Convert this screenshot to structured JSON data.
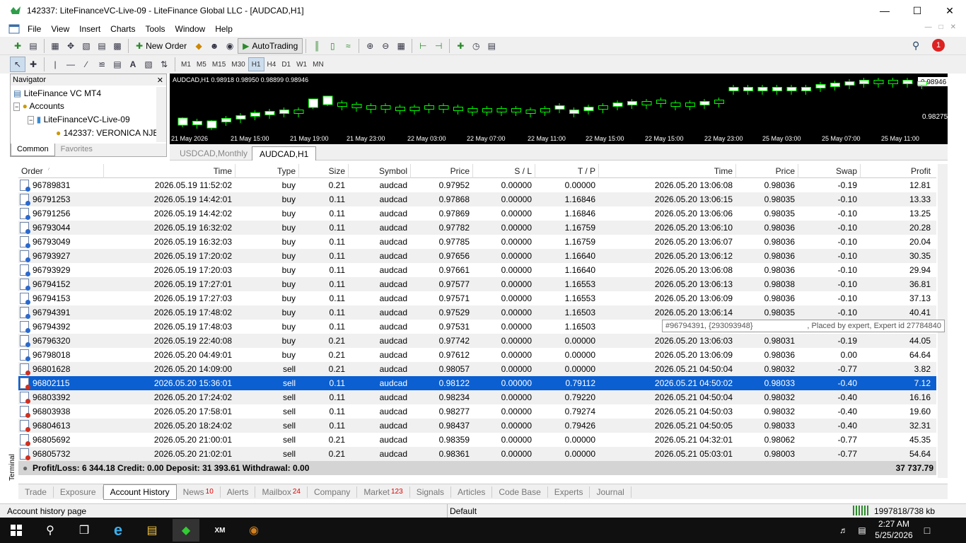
{
  "window": {
    "title": "142337: LiteFinanceVC-Live-09 - LiteFinance Global LLC - [AUDCAD,H1]"
  },
  "menu": [
    "File",
    "View",
    "Insert",
    "Charts",
    "Tools",
    "Window",
    "Help"
  ],
  "toolbar": {
    "new_order": "New Order",
    "autotrading": "AutoTrading",
    "timeframes": [
      "M1",
      "M5",
      "M15",
      "M30",
      "H1",
      "H4",
      "D1",
      "W1",
      "MN"
    ],
    "active_timeframe": "H1",
    "alert_count": "1"
  },
  "navigator": {
    "title": "Navigator",
    "root": "LiteFinance VC MT4",
    "accounts": "Accounts",
    "server": "LiteFinanceVC-Live-09",
    "account": "142337: VERONICA NJE",
    "tabs": [
      "Common",
      "Favorites"
    ]
  },
  "chart": {
    "header": "AUDCAD,H1  0.98918 0.98950 0.98899 0.98946",
    "price_labels": [
      "0.98946",
      "0.98275"
    ],
    "time_labels": [
      "21 May 2026",
      "21 May 15:00",
      "21 May 19:00",
      "21 May 23:00",
      "22 May 03:00",
      "22 May 07:00",
      "22 May 11:00",
      "22 May 15:00",
      "22 May 15:00",
      "22 May 23:00",
      "25 May 03:00",
      "25 May 07:00",
      "25 May 11:00"
    ],
    "tabs": [
      "USDCAD,Monthly",
      "AUDCAD,H1"
    ],
    "colors": {
      "bull": "#ffffff",
      "bear": "#000000",
      "outline": "#00ff00",
      "bg": "#000000"
    }
  },
  "grid": {
    "headers": [
      "Order",
      "Time",
      "Type",
      "Size",
      "Symbol",
      "Price",
      "S / L",
      "T / P",
      "Time",
      "Price",
      "Swap",
      "Profit"
    ],
    "rows": [
      [
        "96789831",
        "2026.05.19 11:52:02",
        "buy",
        "0.21",
        "audcad",
        "0.97952",
        "0.00000",
        "0.00000",
        "2026.05.20 13:06:08",
        "0.98036",
        "-0.19",
        "12.81"
      ],
      [
        "96791253",
        "2026.05.19 14:42:01",
        "buy",
        "0.11",
        "audcad",
        "0.97868",
        "0.00000",
        "1.16846",
        "2026.05.20 13:06:15",
        "0.98035",
        "-0.10",
        "13.33"
      ],
      [
        "96791256",
        "2026.05.19 14:42:02",
        "buy",
        "0.11",
        "audcad",
        "0.97869",
        "0.00000",
        "1.16846",
        "2026.05.20 13:06:06",
        "0.98035",
        "-0.10",
        "13.25"
      ],
      [
        "96793044",
        "2026.05.19 16:32:02",
        "buy",
        "0.11",
        "audcad",
        "0.97782",
        "0.00000",
        "1.16759",
        "2026.05.20 13:06:10",
        "0.98036",
        "-0.10",
        "20.28"
      ],
      [
        "96793049",
        "2026.05.19 16:32:03",
        "buy",
        "0.11",
        "audcad",
        "0.97785",
        "0.00000",
        "1.16759",
        "2026.05.20 13:06:07",
        "0.98036",
        "-0.10",
        "20.04"
      ],
      [
        "96793927",
        "2026.05.19 17:20:02",
        "buy",
        "0.11",
        "audcad",
        "0.97656",
        "0.00000",
        "1.16640",
        "2026.05.20 13:06:12",
        "0.98036",
        "-0.10",
        "30.35"
      ],
      [
        "96793929",
        "2026.05.19 17:20:03",
        "buy",
        "0.11",
        "audcad",
        "0.97661",
        "0.00000",
        "1.16640",
        "2026.05.20 13:06:08",
        "0.98036",
        "-0.10",
        "29.94"
      ],
      [
        "96794152",
        "2026.05.19 17:27:01",
        "buy",
        "0.11",
        "audcad",
        "0.97577",
        "0.00000",
        "1.16553",
        "2026.05.20 13:06:13",
        "0.98038",
        "-0.10",
        "36.81"
      ],
      [
        "96794153",
        "2026.05.19 17:27:03",
        "buy",
        "0.11",
        "audcad",
        "0.97571",
        "0.00000",
        "1.16553",
        "2026.05.20 13:06:09",
        "0.98036",
        "-0.10",
        "37.13"
      ],
      [
        "96794391",
        "2026.05.19 17:48:02",
        "buy",
        "0.11",
        "audcad",
        "0.97529",
        "0.00000",
        "1.16503",
        "2026.05.20 13:06:14",
        "0.98035",
        "-0.10",
        "40.41"
      ],
      [
        "96794392",
        "2026.05.19 17:48:03",
        "buy",
        "0.11",
        "audcad",
        "0.97531",
        "0.00000",
        "1.16503",
        "",
        "",
        "",
        ""
      ],
      [
        "96796320",
        "2026.05.19 22:40:08",
        "buy",
        "0.21",
        "audcad",
        "0.97742",
        "0.00000",
        "0.00000",
        "2026.05.20 13:06:03",
        "0.98031",
        "-0.19",
        "44.05"
      ],
      [
        "96798018",
        "2026.05.20 04:49:01",
        "buy",
        "0.21",
        "audcad",
        "0.97612",
        "0.00000",
        "0.00000",
        "2026.05.20 13:06:09",
        "0.98036",
        "0.00",
        "64.64"
      ],
      [
        "96801628",
        "2026.05.20 14:09:00",
        "sell",
        "0.21",
        "audcad",
        "0.98057",
        "0.00000",
        "0.00000",
        "2026.05.21 04:50:04",
        "0.98032",
        "-0.77",
        "3.82"
      ],
      [
        "96802115",
        "2026.05.20 15:36:01",
        "sell",
        "0.11",
        "audcad",
        "0.98122",
        "0.00000",
        "0.79112",
        "2026.05.21 04:50:02",
        "0.98033",
        "-0.40",
        "7.12"
      ],
      [
        "96803392",
        "2026.05.20 17:24:02",
        "sell",
        "0.11",
        "audcad",
        "0.98234",
        "0.00000",
        "0.79220",
        "2026.05.21 04:50:04",
        "0.98032",
        "-0.40",
        "16.16"
      ],
      [
        "96803938",
        "2026.05.20 17:58:01",
        "sell",
        "0.11",
        "audcad",
        "0.98277",
        "0.00000",
        "0.79274",
        "2026.05.21 04:50:03",
        "0.98032",
        "-0.40",
        "19.60"
      ],
      [
        "96804613",
        "2026.05.20 18:24:02",
        "sell",
        "0.11",
        "audcad",
        "0.98437",
        "0.00000",
        "0.79426",
        "2026.05.21 04:50:05",
        "0.98033",
        "-0.40",
        "32.31"
      ],
      [
        "96805692",
        "2026.05.20 21:00:01",
        "sell",
        "0.21",
        "audcad",
        "0.98359",
        "0.00000",
        "0.00000",
        "2026.05.21 04:32:01",
        "0.98062",
        "-0.77",
        "45.35"
      ],
      [
        "96805732",
        "2026.05.20 21:02:01",
        "sell",
        "0.21",
        "audcad",
        "0.98361",
        "0.00000",
        "0.00000",
        "2026.05.21 05:03:01",
        "0.98003",
        "-0.77",
        "54.64"
      ]
    ],
    "selected_index": 14,
    "summary": "Profit/Loss: 6 344.18  Credit: 0.00  Deposit: 31 393.61  Withdrawal: 0.00",
    "summary_total": "37 737.79"
  },
  "tooltip": {
    "left": "#96794391, {293093948}",
    "right": ", Placed by expert, Expert id 27784840"
  },
  "bottom_tabs": [
    {
      "label": "Trade",
      "badge": ""
    },
    {
      "label": "Exposure",
      "badge": ""
    },
    {
      "label": "Account History",
      "badge": ""
    },
    {
      "label": "News",
      "badge": "10"
    },
    {
      "label": "Alerts",
      "badge": ""
    },
    {
      "label": "Mailbox",
      "badge": "24"
    },
    {
      "label": "Company",
      "badge": ""
    },
    {
      "label": "Market",
      "badge": "123"
    },
    {
      "label": "Signals",
      "badge": ""
    },
    {
      "label": "Articles",
      "badge": ""
    },
    {
      "label": "Code Base",
      "badge": ""
    },
    {
      "label": "Experts",
      "badge": ""
    },
    {
      "label": "Journal",
      "badge": ""
    }
  ],
  "active_bottom_tab": "Account History",
  "terminal_label": "Terminal",
  "status": {
    "left": "Account history page",
    "profile": "Default",
    "traffic": "1997818/738 kb"
  },
  "taskbar": {
    "time": "2:27 AM",
    "date": "5/25/2026"
  }
}
